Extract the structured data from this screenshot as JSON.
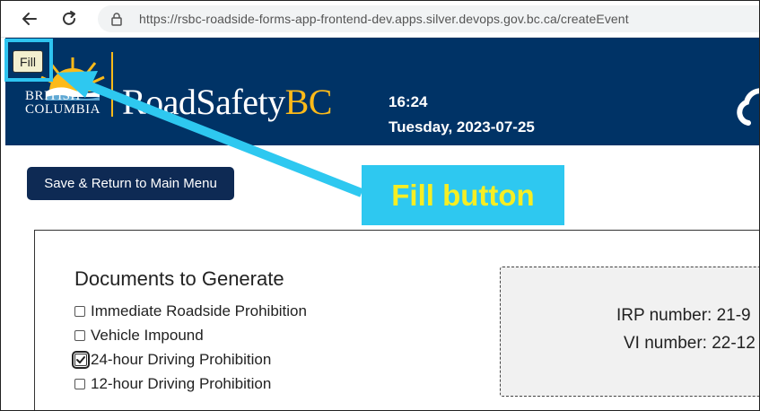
{
  "browser": {
    "url": "https://rsbc-roadside-forms-app-frontend-dev.apps.silver.devops.gov.bc.ca/createEvent"
  },
  "header": {
    "bc_logo_line1": "BRITISH",
    "bc_logo_line2": "COLUMBIA",
    "brand_road_safety": "RoadSafety",
    "brand_bc": "BC",
    "time": "16:24",
    "date": "Tuesday, 2023-07-25",
    "colors": {
      "header_bg": "#003366",
      "gold": "#fcba19"
    }
  },
  "fill_button": {
    "label": "Fill"
  },
  "callout": {
    "text": "Fill button",
    "colors": {
      "bg": "#2ec8f0",
      "text": "#f6ee23"
    }
  },
  "save_button": {
    "label": "Save & Return to Main Menu"
  },
  "documents": {
    "title": "Documents to Generate",
    "options": [
      {
        "label": "Immediate Roadside Prohibition",
        "checked": false
      },
      {
        "label": "Vehicle Impound",
        "checked": false
      },
      {
        "label": "24-hour Driving Prohibition",
        "checked": true
      },
      {
        "label": "12-hour Driving Prohibition",
        "checked": false
      }
    ]
  },
  "numbers": {
    "irp": "IRP number: 21-9",
    "vi": "VI number: 22-12"
  },
  "icons": {
    "back": "back-arrow-icon",
    "reload": "reload-icon",
    "lock": "lock-icon",
    "cloud": "cloud-icon"
  }
}
